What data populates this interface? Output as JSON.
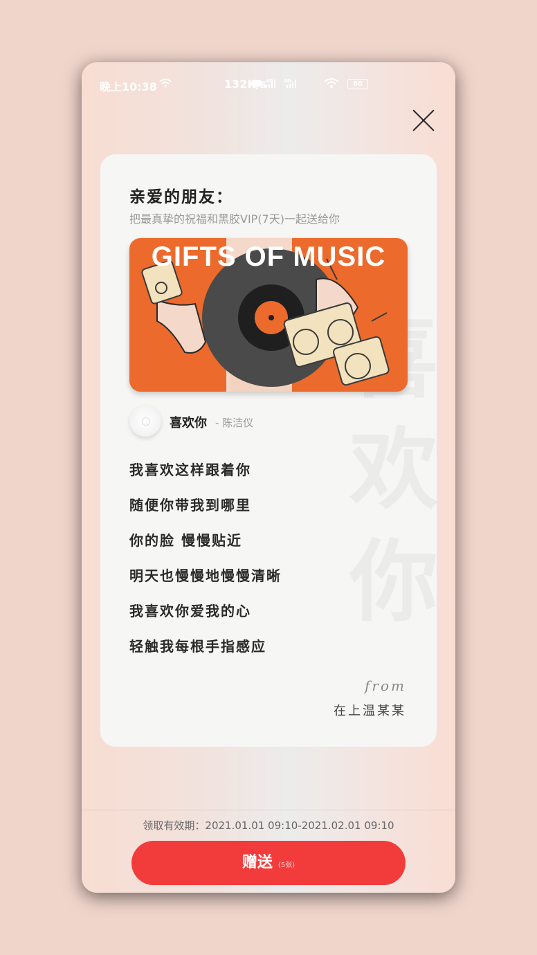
{
  "status_bar": {
    "time": "晚上10:38",
    "network_speed": "132K/s",
    "signal_label": "4G",
    "battery": "60"
  },
  "card": {
    "greeting": "亲爱的朋友：",
    "subtitle": "把最真挚的祝福和黑胶VIP(7天)一起送给你",
    "banner_title": "GIFTS OF MUSIC",
    "watermark": "喜欢你",
    "song": {
      "name": "喜欢你",
      "artist": "- 陈洁仪"
    },
    "lyrics": [
      "我喜欢这样跟着你",
      "随便你带我到哪里",
      "你的脸 慢慢贴近",
      "明天也慢慢地慢慢清晰",
      "我喜欢你爱我的心",
      "轻触我每根手指感应"
    ],
    "from_label": "from",
    "from_name": "在上温某某"
  },
  "footer": {
    "validity": "领取有效期：2021.01.01 09:10-2021.02.01 09:10",
    "gift_button_label": "赠送",
    "gift_count": "(5张)"
  },
  "colors": {
    "accent": "#f23c3c",
    "banner": "#ec6a2c"
  }
}
